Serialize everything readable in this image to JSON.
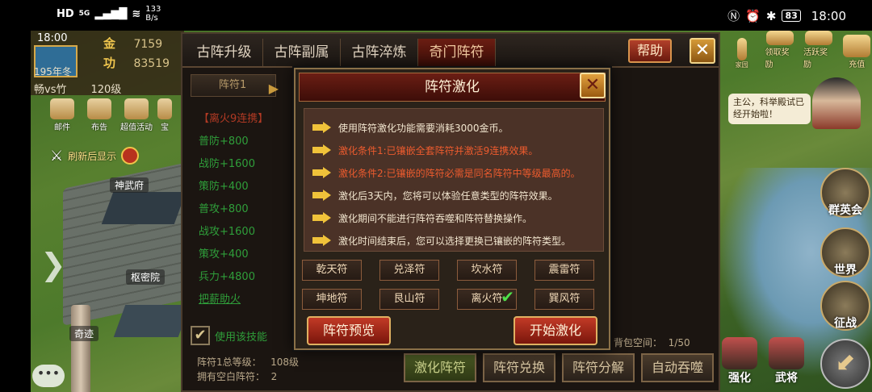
{
  "status_bar": {
    "network": "HD",
    "signal": "5G",
    "speed_value": "133",
    "speed_unit": "B/s",
    "battery": "83",
    "time": "18:00"
  },
  "player": {
    "clock": "18:00",
    "gold_label": "金",
    "gold_value": "7159",
    "merit_label": "功",
    "merit_value": "83519",
    "season": "195年冬",
    "vs": "畅vs竹",
    "level": "120级"
  },
  "quick_icons": [
    "邮件",
    "布告",
    "超值活动",
    "宝"
  ],
  "map": {
    "refresh_text": "刷新后显示",
    "shenwu": "神武府",
    "shumi": "枢密院",
    "qiji": "奇迹",
    "chat_icon": "•••"
  },
  "right_side": {
    "top_icons": [
      "家园",
      "领取奖励",
      "活跃奖励",
      "充值"
    ],
    "advisor_text": "主公，科举殿试已经开始啦！",
    "side_buttons": [
      "群英会",
      "世界",
      "征战"
    ],
    "bottom_buttons": [
      "强化",
      "武将"
    ]
  },
  "main_panel": {
    "tabs": [
      "古阵升级",
      "古阵副属",
      "古阵淬炼",
      "奇门阵符"
    ],
    "active_tab": 3,
    "help": "帮助",
    "close": "✕",
    "rune_slot": "阵符1",
    "set_name": "【离火9连携】",
    "stats": [
      "普防+800",
      "战防+1600",
      "策防+400",
      "普攻+800",
      "战攻+1600",
      "策攻+400",
      "兵力+4800"
    ],
    "link": "把薪助火",
    "use_skill_label": "使用该技能",
    "total_level_label": "阵符1总等级：",
    "total_level_value": "108级",
    "blank_label": "拥有空白阵符：",
    "blank_value": "2",
    "bag_label": "背包空间：",
    "bag_value": "1/50",
    "bottom_buttons": [
      "激化阵符",
      "阵符兑换",
      "阵符分解",
      "自动吞噬"
    ]
  },
  "modal": {
    "title": "阵符激化",
    "close": "✕",
    "lines": [
      {
        "text": "使用阵符激化功能需要消耗3000金币。",
        "style": "normal"
      },
      {
        "text": "激化条件1:已镶嵌全套阵符并激活9连携效果。",
        "style": "red"
      },
      {
        "text": "激化条件2:已镶嵌的阵符必需是同名阵符中等级最高的。",
        "style": "red"
      },
      {
        "text": "激化后3天内，您将可以体验任意类型的阵符效果。",
        "style": "normal"
      },
      {
        "text": "激化期间不能进行阵符吞噬和阵符替换操作。",
        "style": "normal"
      },
      {
        "text": "激化时间结束后，您可以选择更换已镶嵌的阵符类型。",
        "style": "normal"
      }
    ],
    "runes": [
      "乾天符",
      "兑泽符",
      "坎水符",
      "震雷符",
      "坤地符",
      "艮山符",
      "离火符",
      "巽风符"
    ],
    "selected_rune": "离火符",
    "preview_button": "阵符预览",
    "start_button": "开始激化",
    "colors": {
      "red_text": "#ec5b2e",
      "normal_text": "#f2e6cf",
      "accent": "#c23a26"
    }
  }
}
